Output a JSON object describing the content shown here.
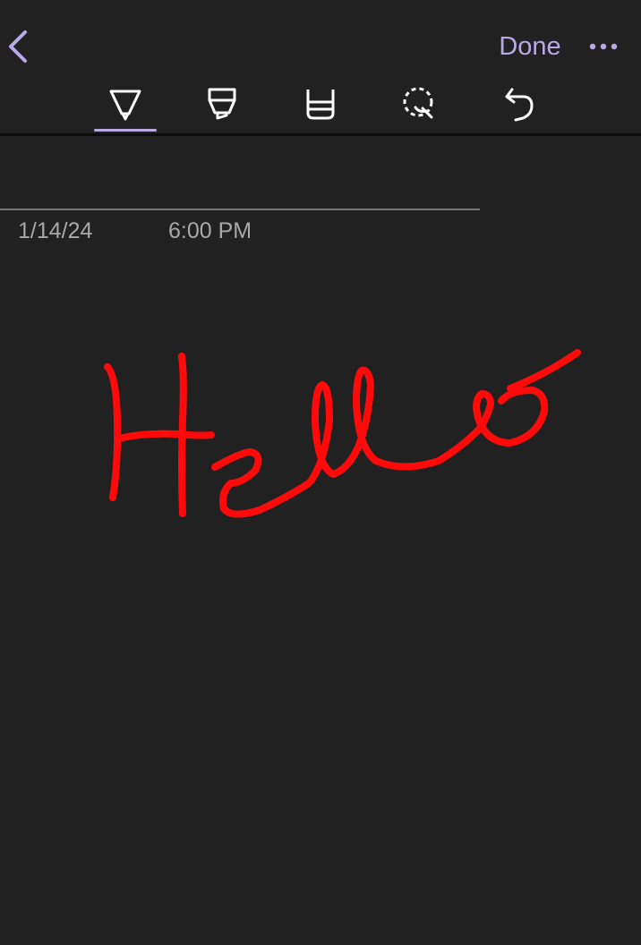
{
  "toolbar": {
    "done_label": "Done",
    "tools": [
      {
        "icon": "pen-icon",
        "active": true
      },
      {
        "icon": "highlighter-icon",
        "active": false
      },
      {
        "icon": "eraser-icon",
        "active": false
      },
      {
        "icon": "lasso-select-icon",
        "active": false
      },
      {
        "icon": "undo-icon",
        "active": false
      }
    ]
  },
  "page": {
    "date": "1/14/24",
    "time": "6:00 PM"
  },
  "ink": {
    "handwritten_text": "Hello",
    "color": "#ff0a0a"
  },
  "colors": {
    "accent": "#b8a9e6",
    "background": "#222121",
    "toolbar_icon": "#ffffff"
  }
}
